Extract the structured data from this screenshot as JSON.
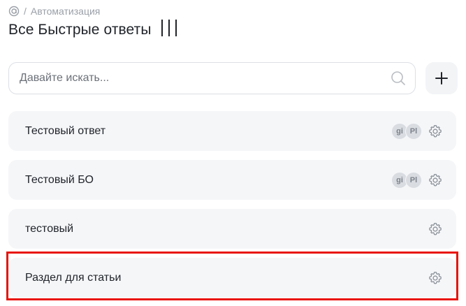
{
  "breadcrumb": {
    "icon": "workspace-icon",
    "separator": "/",
    "section": "Автоматизация"
  },
  "header": {
    "title": "Все Быстрые ответы",
    "columns_icon": "columns-icon"
  },
  "search": {
    "placeholder": "Давайте искать...",
    "value": "",
    "icon": "search-icon"
  },
  "add_button": {
    "icon": "plus-icon"
  },
  "quick_replies": [
    {
      "label": "Тестовый ответ",
      "avatars": [
        "gi",
        "Pl"
      ]
    },
    {
      "label": "Тестовый БО",
      "avatars": [
        "gi",
        "Pl"
      ]
    },
    {
      "label": "тестовый",
      "avatars": []
    },
    {
      "label": "Раздел для статьи",
      "avatars": [],
      "highlighted": true
    }
  ],
  "colors": {
    "highlight": "#e8140c",
    "row_background": "#f5f6f8",
    "text": "#1f2329",
    "muted_text": "#9aa0a8"
  }
}
